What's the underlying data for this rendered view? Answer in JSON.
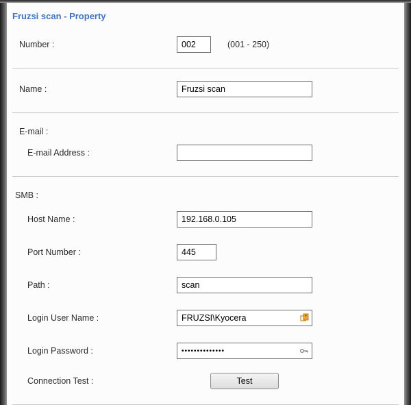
{
  "title": "Fruzsi scan - Property",
  "fields": {
    "number_label": "Number :",
    "number_value": "002",
    "number_hint": "(001 - 250)",
    "name_label": "Name :",
    "name_value": "Fruzsi scan",
    "email_section": "E-mail :",
    "email_addr_label": "E-mail Address :",
    "email_addr_value": "",
    "smb_section": "SMB :",
    "host_label": "Host Name :",
    "host_value": "192.168.0.105",
    "port_label": "Port Number :",
    "port_value": "445",
    "path_label": "Path :",
    "path_value": "scan",
    "user_label": "Login User Name :",
    "user_value": "FRUZSI\\Kyocera",
    "pass_label": "Login Password :",
    "pass_value": "••••••••••••••",
    "conn_label": "Connection Test :",
    "test_btn": "Test"
  }
}
